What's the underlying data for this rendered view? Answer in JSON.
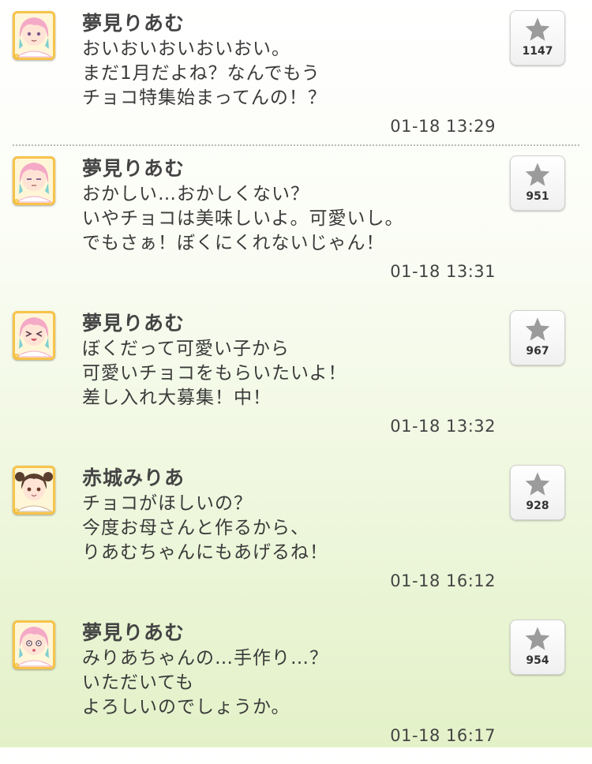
{
  "posts": [
    {
      "author": "夢見りあむ",
      "lines": [
        "おいおいおいおいおい。",
        "まだ1月だよね？なんでもう",
        "チョコ特集始まってんの！？"
      ],
      "time": "01-18 13:29",
      "likes": "1147",
      "avatar": "pink-hair-avatar"
    },
    {
      "author": "夢見りあむ",
      "lines": [
        "おかしい…おかしくない？",
        "いやチョコは美味しいよ。可愛いし。",
        "でもさぁ！ぼくにくれないじゃん！"
      ],
      "time": "01-18 13:31",
      "likes": "951",
      "avatar": "pink-hair-avatar"
    },
    {
      "author": "夢見りあむ",
      "lines": [
        "ぼくだって可愛い子から",
        "可愛いチョコをもらいたいよ！",
        "差し入れ大募集！中！"
      ],
      "time": "01-18 13:32",
      "likes": "967",
      "avatar": "pink-hair-avatar"
    },
    {
      "author": "赤城みりあ",
      "lines": [
        "チョコがほしいの？",
        "今度お母さんと作るから、",
        "りあむちゃんにもあげるね！"
      ],
      "time": "01-18 16:12",
      "likes": "928",
      "avatar": "brown-hair-avatar"
    },
    {
      "author": "夢見りあむ",
      "lines": [
        "みりあちゃんの…手作り…？",
        "いただいても",
        "よろしいのでしょうか。"
      ],
      "time": "01-18 16:17",
      "likes": "954",
      "avatar": "pink-hair-avatar"
    }
  ],
  "colors": {
    "pink_hair": "#f4a9c6",
    "brown_hair": "#5a3e2e",
    "avatar_frame": "#f7c44a",
    "star": "#9b9b9b"
  },
  "icons": {
    "like": "star-icon"
  }
}
